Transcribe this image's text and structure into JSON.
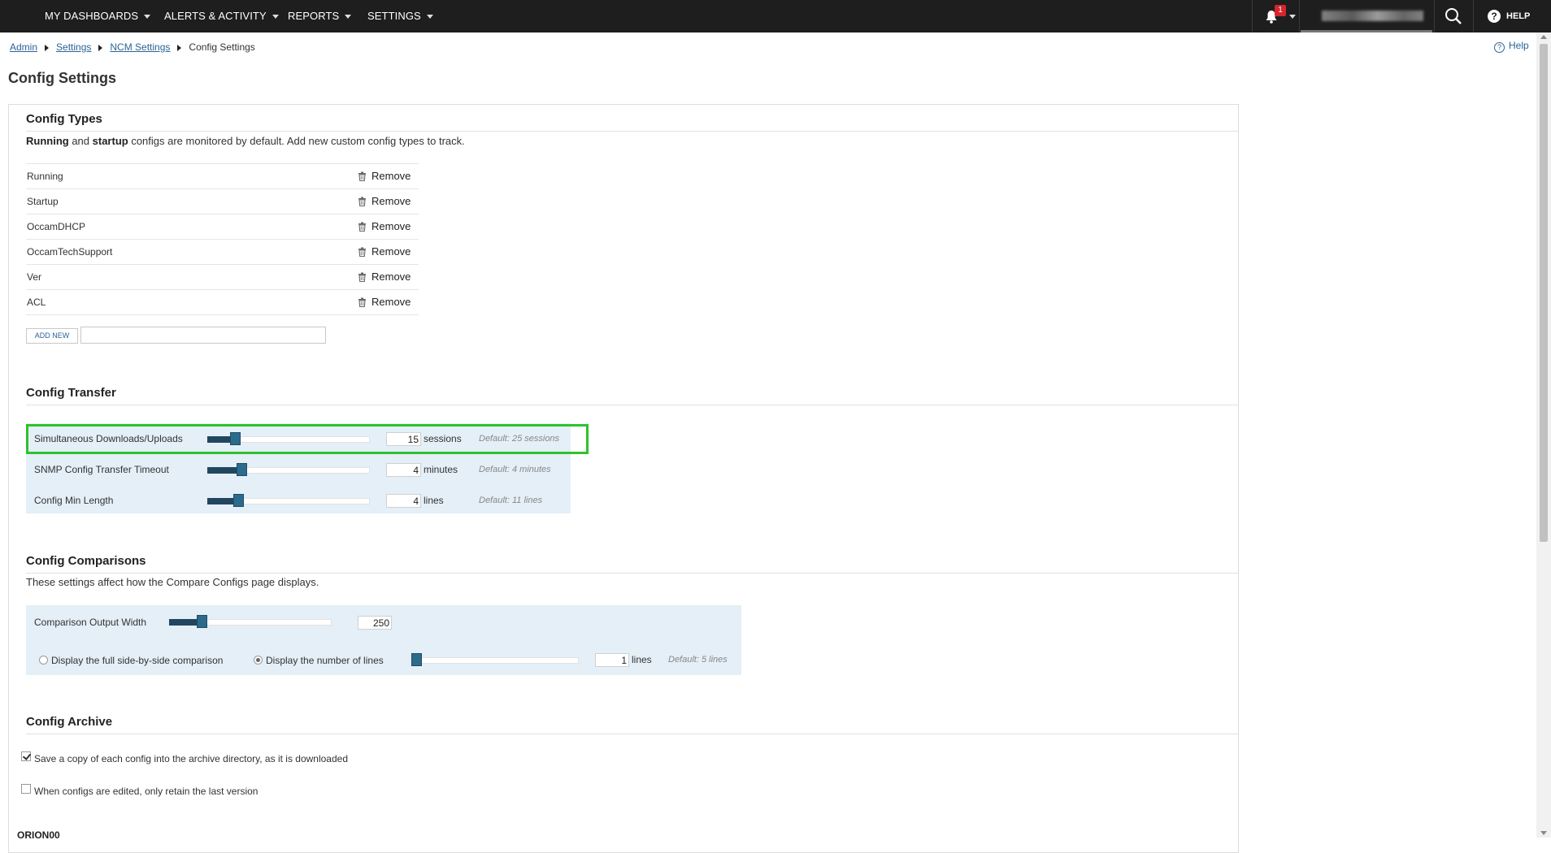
{
  "nav": {
    "items": [
      "MY DASHBOARDS",
      "ALERTS & ACTIVITY",
      "REPORTS",
      "SETTINGS"
    ],
    "notification_count": "1",
    "help_label": "HELP"
  },
  "breadcrumb": [
    "Admin",
    "Settings",
    "NCM Settings",
    "Config Settings"
  ],
  "help_link": "Help",
  "page_title": "Config Settings",
  "config_types": {
    "title": "Config Types",
    "desc_bold1": "Running",
    "desc_mid": " and ",
    "desc_bold2": "startup",
    "desc_rest": " configs are monitored by default. Add new custom config types to track.",
    "remove_label": "Remove",
    "types": [
      "Running",
      "Startup",
      "OccamDHCP",
      "OccamTechSupport",
      "Ver",
      "ACL"
    ],
    "add_new_label": "ADD NEW",
    "add_new_value": ""
  },
  "config_transfer": {
    "title": "Config Transfer",
    "settings": [
      {
        "label": "Simultaneous Downloads/Uploads",
        "value": "15",
        "unit": "sessions",
        "default": "Default: 25 sessions",
        "level": 0.14
      },
      {
        "label": "SNMP Config Transfer Timeout",
        "value": "4",
        "unit": "minutes",
        "default": "Default: 4 minutes",
        "level": 0.18
      },
      {
        "label": "Config Min Length",
        "value": "4",
        "unit": "lines",
        "default": "Default: 11 lines",
        "level": 0.16
      }
    ]
  },
  "config_comparisons": {
    "title": "Config Comparisons",
    "desc": "These settings affect how the Compare Configs page displays.",
    "output_width_label": "Comparison Output Width",
    "output_width_value": "250",
    "output_width_level": 0.17,
    "radio_full_label": "Display the full side-by-side comparison",
    "radio_lines_label": "Display the number of lines",
    "lines_value": "1",
    "lines_unit": "lines",
    "lines_default": "Default: 5 lines",
    "lines_level": 0.0
  },
  "config_archive": {
    "title": "Config Archive",
    "save_copy_label": "Save a copy of each config into the archive directory, as it is downloaded",
    "save_copy_checked": true,
    "retain_last_label": "When configs are edited, only retain the last version",
    "retain_last_checked": false,
    "server_label": "ORION00"
  }
}
